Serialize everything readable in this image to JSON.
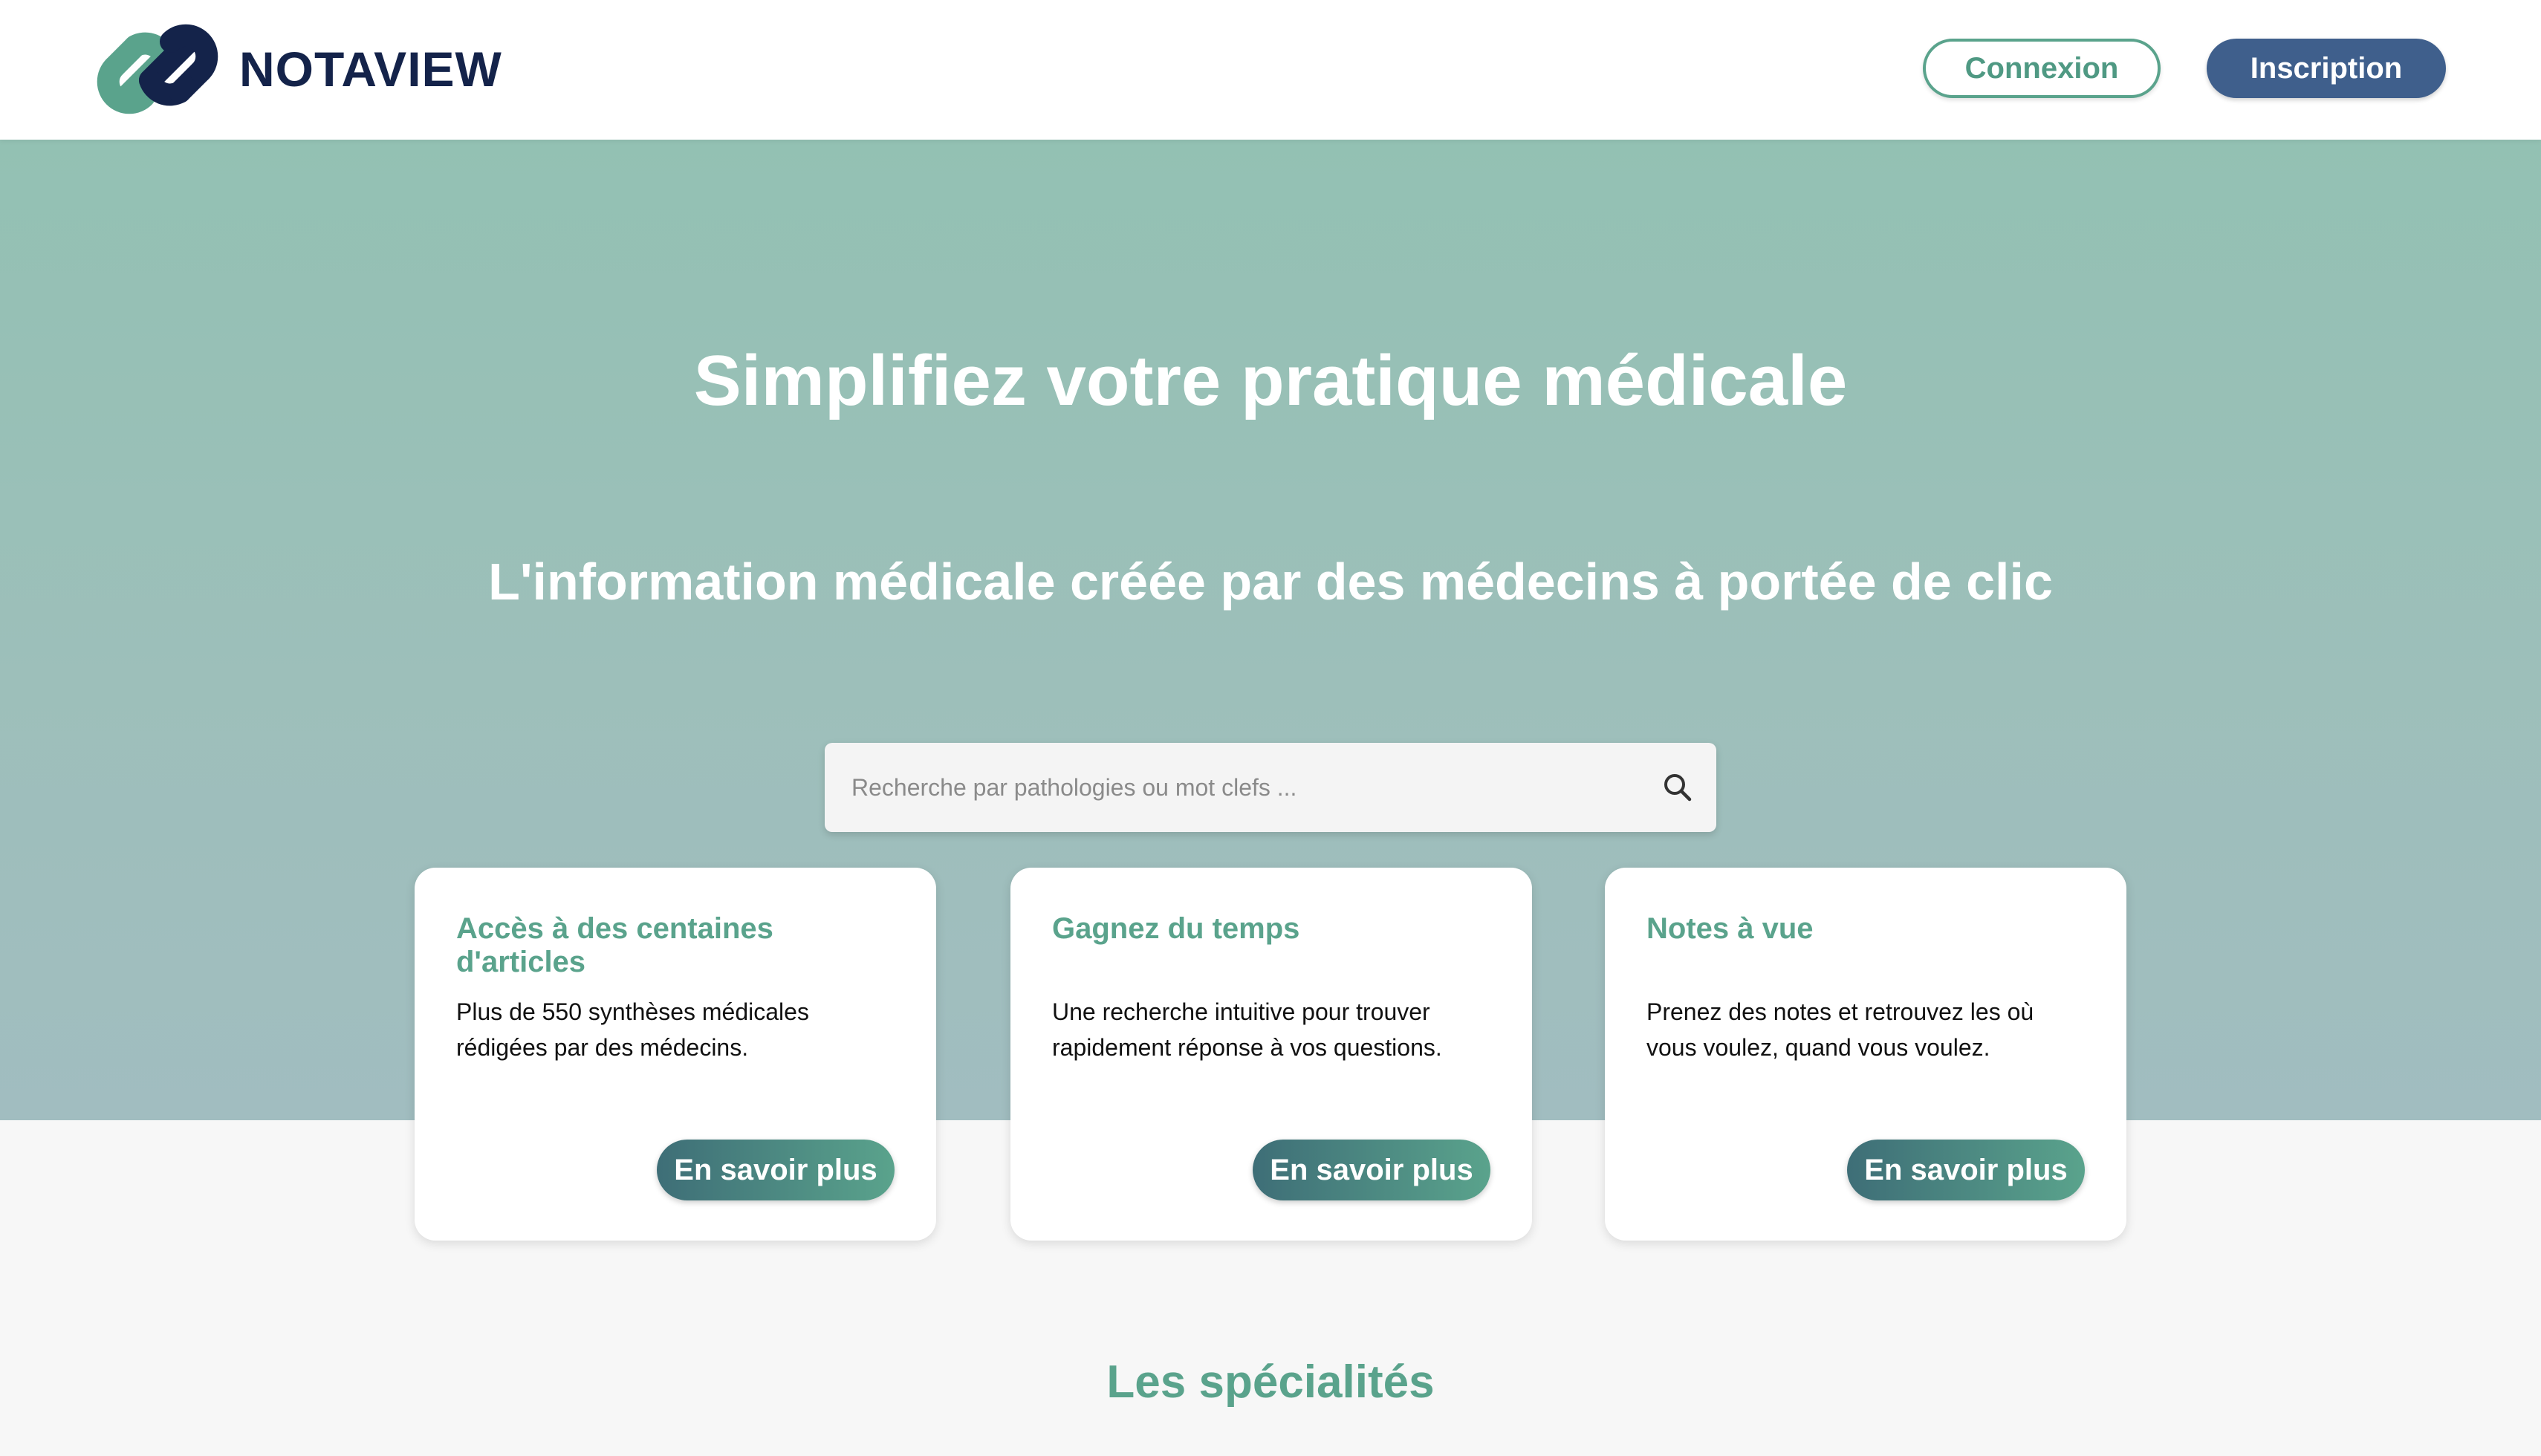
{
  "header": {
    "brand": "NOTAVIEW",
    "login_label": "Connexion",
    "signup_label": "Inscription"
  },
  "hero": {
    "title": "Simplifiez votre pratique médicale",
    "subtitle": "L'information médicale créée par des médecins à portée de clic"
  },
  "search": {
    "placeholder": "Recherche par pathologies ou mot clefs ...",
    "value": "",
    "icon": "search-icon"
  },
  "features": [
    {
      "title": "Accès à des centaines d'articles",
      "text": "Plus de 550 synthèses médicales rédigées par des médecins.",
      "button": "En savoir plus"
    },
    {
      "title": "Gagnez du temps",
      "text": "Une recherche intuitive pour trouver rapidement réponse à vos questions.",
      "button": "En savoir plus"
    },
    {
      "title": "Notes à vue",
      "text": "Prenez des notes et retrouvez les où vous voulez, quand vous voulez.",
      "button": "En savoir plus"
    }
  ],
  "specialties": {
    "title": "Les spécialités"
  },
  "colors": {
    "brand_dark": "#14234a",
    "brand_green": "#5aa38c",
    "signup_blue": "#3f5f8c",
    "hero_top": "#93c1b3",
    "hero_bottom": "#a1bdc0"
  }
}
